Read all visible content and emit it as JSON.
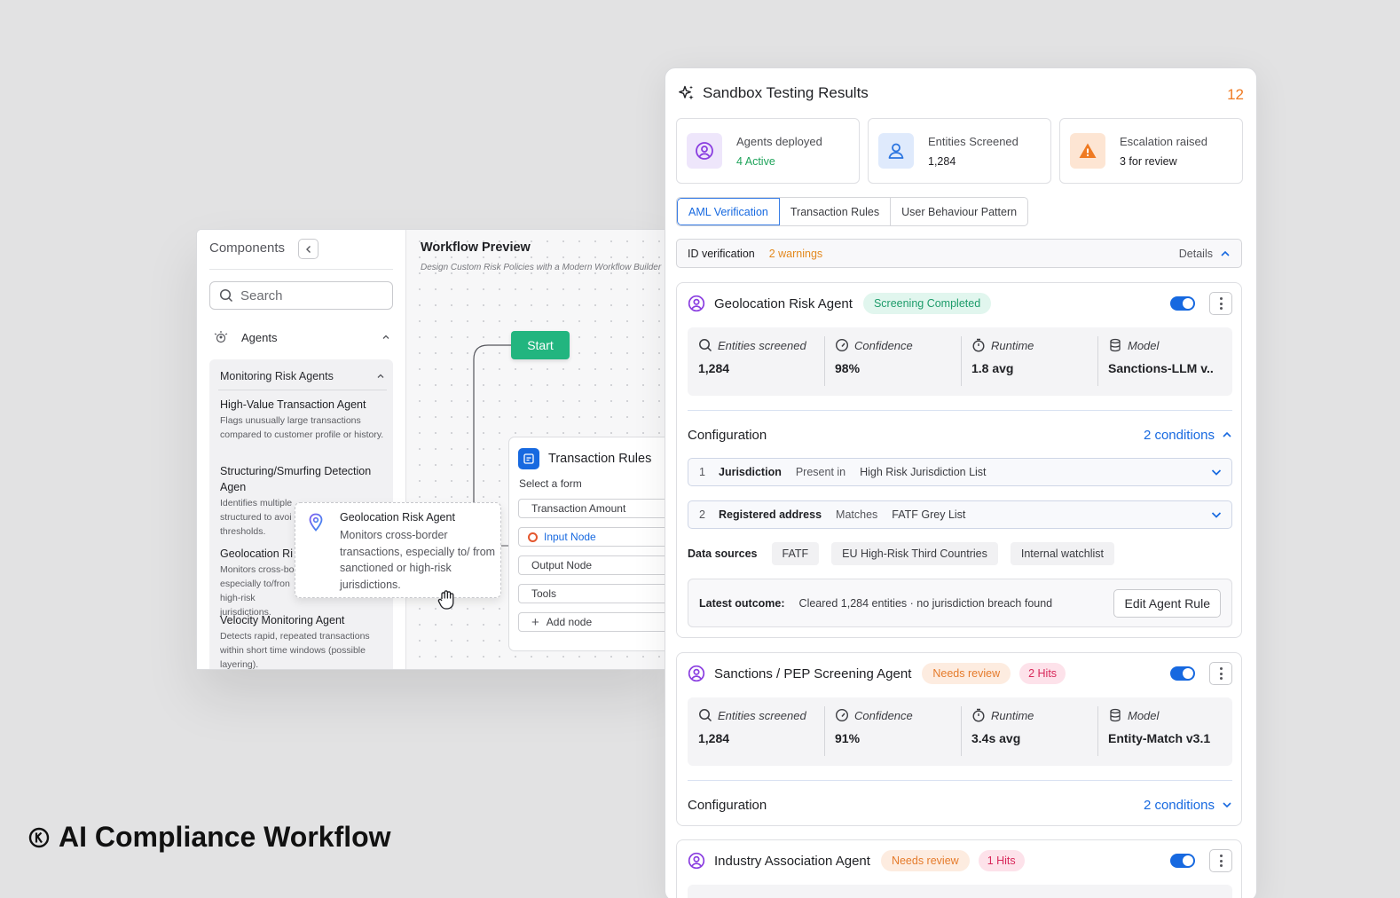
{
  "components": {
    "title": "Components",
    "search_placeholder": "Search",
    "agents_label": "Agents",
    "group_title": "Monitoring Risk Agents",
    "agents": [
      {
        "name": "High-Value Transaction Agent",
        "desc": "Flags unusually large transactions compared to customer profile or history."
      },
      {
        "name": "Structuring/Smurfing Detection Agen",
        "desc": "Identifies multiple structured to avoi thresholds."
      },
      {
        "name": "Geolocation Ri",
        "desc": "Monitors cross-bo especially to/fron high-risk jurisdictions."
      },
      {
        "name": "Velocity Monitoring Agent",
        "desc": "Detects rapid, repeated transactions within short time windows (possible layering)."
      }
    ]
  },
  "workflow": {
    "title": "Workflow Preview",
    "subtitle": "Design Custom Risk Policies with a Modern Workflow Builder",
    "start_label": "Start",
    "card_title": "Transaction Rules",
    "card_subtitle": "Select a form",
    "fields": [
      "Transaction Amount",
      "Input Node",
      "Output Node",
      "Tools",
      "Add node"
    ]
  },
  "tooltip": {
    "title": "Geolocation Risk Agent",
    "desc": "Monitors cross-border transactions, especially to/ from sanctioned or high-risk jurisdictions."
  },
  "panel": {
    "title": "Sandbox Testing Results",
    "count": "12",
    "stats": [
      {
        "label": "Agents deployed",
        "value": "4 Active",
        "color": "#1ea35a",
        "icon": "agent-icon"
      },
      {
        "label": "Entities Screened",
        "value": "1,284",
        "color": "#1f2024",
        "icon": "user-icon"
      },
      {
        "label": "Escalation raised",
        "value": "3 for review",
        "color": "#1f2024",
        "icon": "warning-icon"
      }
    ],
    "tabs": [
      "AML Verification",
      "Transaction Rules",
      "User Behaviour Pattern"
    ],
    "id_verification": {
      "label": "ID verification",
      "warnings": "2 warnings",
      "details": "Details"
    },
    "metric_labels": [
      "Entities screened",
      "Confidence",
      "Runtime",
      "Model"
    ],
    "config_label": "Configuration",
    "cards": [
      {
        "name": "Geolocation Risk Agent",
        "status": "Screening Completed",
        "metrics": [
          "1,284",
          "98%",
          "1.8 avg",
          "Sanctions-LLM v.."
        ],
        "conditions_label": "2 conditions",
        "conditions": [
          {
            "no": "1",
            "field": "Jurisdiction",
            "op": "Present in",
            "value": "High Risk Jurisdiction List"
          },
          {
            "no": "2",
            "field": "Registered address",
            "op": "Matches",
            "value": "FATF Grey List"
          }
        ],
        "sources_label": "Data sources",
        "sources": [
          "FATF",
          "EU High-Risk Third Countries",
          "Internal watchlist"
        ],
        "outcome_label": "Latest outcome:",
        "outcome": "Cleared 1,284 entities · no jurisdiction breach found",
        "edit_label": "Edit Agent Rule"
      },
      {
        "name": "Sanctions / PEP Screening Agent",
        "status": "Needs review",
        "hits": "2 Hits",
        "metrics": [
          "1,284",
          "91%",
          "3.4s avg",
          "Entity-Match v3.1"
        ],
        "conditions_label": "2 conditions"
      },
      {
        "name": "Industry Association Agent",
        "status": "Needs review",
        "hits": "1 Hits"
      }
    ]
  },
  "brand": {
    "title": "AI Compliance Workflow"
  },
  "colors": {
    "accent": "#1769e0",
    "green": "#22b57f",
    "orange": "#ef7a22"
  }
}
